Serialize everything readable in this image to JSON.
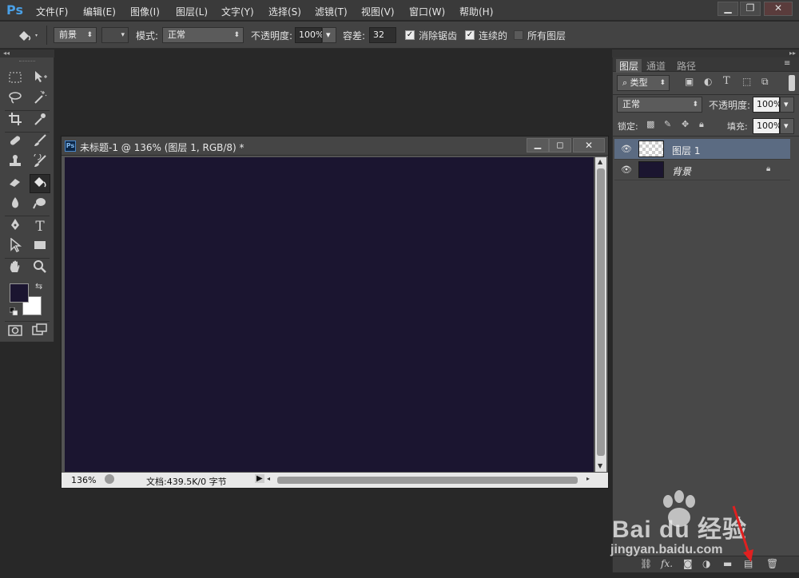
{
  "app": {
    "logo": "Ps"
  },
  "menu": [
    "文件(F)",
    "编辑(E)",
    "图像(I)",
    "图层(L)",
    "文字(Y)",
    "选择(S)",
    "滤镜(T)",
    "视图(V)",
    "窗口(W)",
    "帮助(H)"
  ],
  "window_controls": {
    "minimize": "▁",
    "restore": "❐",
    "close": "✕"
  },
  "options": {
    "fill_source": "前景",
    "mode_label": "模式:",
    "mode_value": "正常",
    "opacity_label": "不透明度:",
    "opacity_value": "100%",
    "tolerance_label": "容差:",
    "tolerance_value": "32",
    "antialias_label": "消除锯齿",
    "antialias_checked": true,
    "contiguous_label": "连续的",
    "contiguous_checked": true,
    "all_layers_label": "所有图层",
    "all_layers_checked": false
  },
  "tools": {
    "foreground_color": "#1b1530",
    "background_color": "#ffffff",
    "type_tool_label": "T"
  },
  "document": {
    "title": "未标题-1 @ 136% (图层 1, RGB/8) *",
    "zoom": "136%",
    "doc_info": "文档:439.5K/0 字节",
    "canvas_color": "#1b1530",
    "ps_badge": "Ps"
  },
  "layers_panel": {
    "tabs": [
      "图层",
      "通道",
      "路径"
    ],
    "active_tab": 0,
    "filter_kind": "类型",
    "blend_mode": "正常",
    "opacity_label": "不透明度:",
    "opacity_value": "100%",
    "lock_label": "锁定:",
    "fill_label": "填充:",
    "fill_value": "100%",
    "layers": [
      {
        "name": "图层 1",
        "selected": true,
        "thumb": "transparent"
      },
      {
        "name": "背景",
        "selected": false,
        "thumb": "#1b1530",
        "locked": true
      }
    ]
  },
  "watermark": {
    "brand": "Bai du 经验",
    "url": "jingyan.baidu.com"
  }
}
